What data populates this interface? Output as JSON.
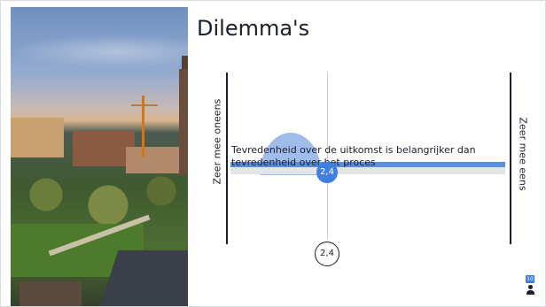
{
  "slide": {
    "title": "Dilemma's",
    "left_label": "Zeer mee oneens",
    "right_label": "Zeer mee eens",
    "statement": "Tevredenheid over de uitkomst is belangrijker dan tevredenheid over het proces",
    "mean_value": "2,4",
    "mean_value_axis": "2,4"
  },
  "footer": {
    "respondent_count": "10",
    "respondents_icon": "person-icon"
  },
  "colors": {
    "accent": "#3f7fe0",
    "bar": "#5b8fdd",
    "distribution": "#7fa6e4",
    "text": "#1b1e2b"
  },
  "image": {
    "description_icon": "city-aerial-photo"
  }
}
